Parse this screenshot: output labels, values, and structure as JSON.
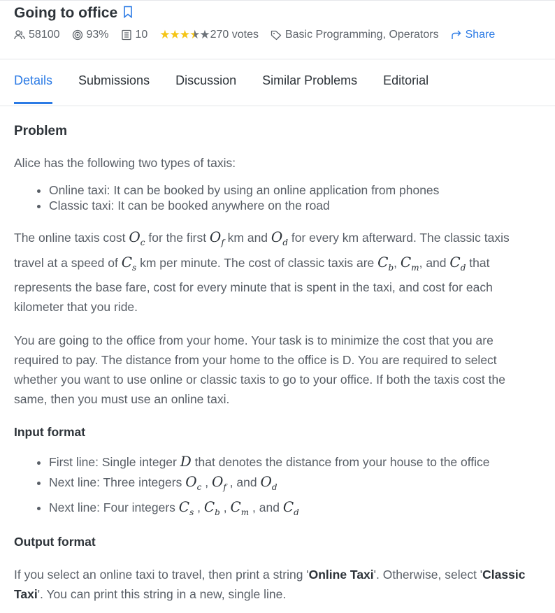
{
  "problem": {
    "title": "Going to office",
    "stats": {
      "submissions": "58100",
      "success_rate": "93%",
      "points": "10",
      "stars_filled": 3.5,
      "stars_total": 5,
      "votes": "270 votes",
      "tags": "Basic Programming, Operators",
      "share_label": "Share"
    },
    "icons": {
      "title": "bookmark-icon",
      "submissions": "users-icon",
      "success": "target-icon",
      "points": "list-icon",
      "tags": "tag-icon",
      "share": "share-arrow-icon"
    }
  },
  "tabs": [
    {
      "label": "Details",
      "active": true
    },
    {
      "label": "Submissions",
      "active": false
    },
    {
      "label": "Discussion",
      "active": false
    },
    {
      "label": "Similar Problems",
      "active": false
    },
    {
      "label": "Editorial",
      "active": false
    }
  ],
  "colors": {
    "accent": "#2c7be5",
    "star": "#f5c518",
    "text": "#585e66",
    "heading": "#2d3339"
  },
  "content": {
    "problem_heading": "Problem",
    "intro": "Alice has the following two types of taxis:",
    "taxi_types": [
      "Online taxi: It can be booked by using an online application from phones",
      "Classic taxi: It can be booked anywhere on the road"
    ],
    "para1": {
      "t1": "The online taxis cost ",
      "t2": " for the first ",
      "t3": " km and ",
      "t4": " for every km afterward. The classic taxis travel at a speed of ",
      "t5": " km per minute. The cost of classic taxis are ",
      "t6": ", ",
      "t7": ", and ",
      "t8": " that represents the base fare, cost for every minute that is spent in the taxi, and cost for each kilometer that you ride."
    },
    "para2": "You are going to the office from your home. Your task is to minimize the cost that you are required to pay. The distance from your home to the office is D. You are required to select whether you want to use online or classic taxis to go to your office. If both the taxis cost the same, then you must use an online taxi.",
    "input_heading": "Input format",
    "input_lines": {
      "l1a": "First line: Single integer ",
      "l1b": " that denotes the distance from your house to the office",
      "l2a": "Next line: Three integers ",
      "l3a": "Next line: Four integers ",
      "comma": " , ",
      "and": " , and "
    },
    "output_heading": "Output format",
    "output": {
      "t1": "If you select an online taxi to travel, then print a string '",
      "online": "Online Taxi",
      "t2": "'. Otherwise, select '",
      "classic": "Classic Taxi",
      "t3": "'. You can print this string in a new, single line."
    },
    "math": {
      "O": "O",
      "C": "C",
      "D": "D",
      "c": "c",
      "f": "f",
      "d": "d",
      "s": "s",
      "b": "b",
      "m": "m"
    }
  }
}
